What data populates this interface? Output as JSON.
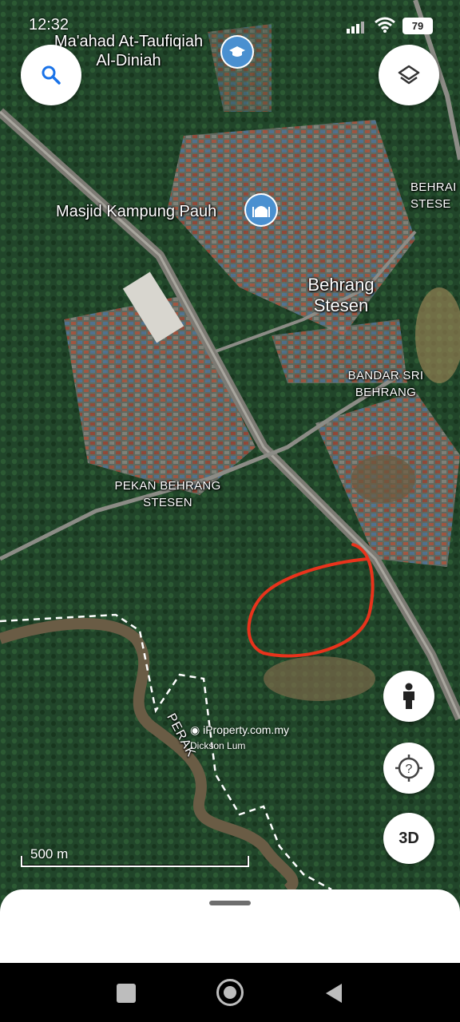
{
  "status_bar": {
    "time": "12:32",
    "battery": "79"
  },
  "map": {
    "places": {
      "school": "Ma'ahad At-Taufiqiah Al-Diniah",
      "mosque": "Masjid Kampung Pauh",
      "town_main_line1": "Behrang",
      "town_main_line2": "Stesen",
      "edge_label_line1": "BEHRAI",
      "edge_label_line2": "STESE",
      "bandar_line1": "BANDAR SRI",
      "bandar_line2": "BEHRANG",
      "pekan_line1": "PEKAN BEHRANG",
      "pekan_line2": "STESEN",
      "boundary": "PERAK"
    },
    "watermark": {
      "site": "iProperty.com.my",
      "agent": "Dickson Lum"
    },
    "scale": {
      "label": "500 m"
    }
  },
  "controls": {
    "three_d_label": "3D"
  },
  "colors": {
    "accent_circle": "#e8331c",
    "road": "#8c8c86",
    "boundary": "#ffffff"
  }
}
